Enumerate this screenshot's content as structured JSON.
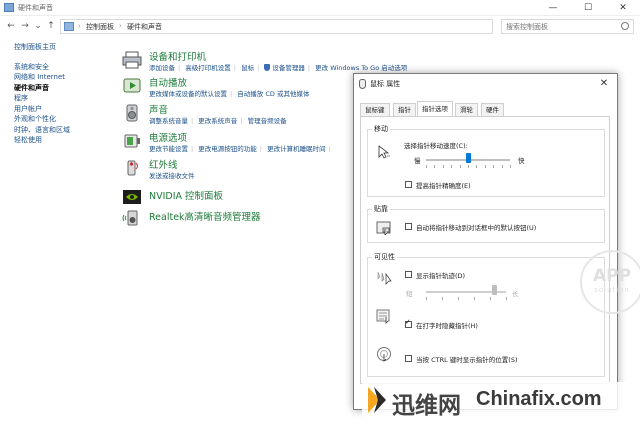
{
  "window": {
    "title": "硬件和声音",
    "minimize": "—",
    "maximize": "☐",
    "close": "✕"
  },
  "nav": {
    "back": "←",
    "forward": "→",
    "recent": "⌄",
    "up": "↑",
    "breadcrumb": [
      "控制面板",
      "硬件和声音"
    ],
    "breadcrumb_sep": "›",
    "search_placeholder": "搜索控制面板"
  },
  "sidebar": {
    "items": [
      {
        "label": "控制面板主页"
      },
      {
        "label": "系统和安全"
      },
      {
        "label": "网络和 Internet"
      },
      {
        "label": "硬件和声音"
      },
      {
        "label": "程序"
      },
      {
        "label": "用户帐户"
      },
      {
        "label": "外观和个性化"
      },
      {
        "label": "时钟、语言和区域"
      },
      {
        "label": "轻松使用"
      }
    ]
  },
  "categories": [
    {
      "title": "设备和打印机",
      "icon": "printer-icon",
      "links": [
        "添加设备",
        "高级打印机设置",
        "鼠标",
        "设备管理器",
        "更改 Windows To Go 启动选项"
      ]
    },
    {
      "title": "自动播放",
      "icon": "autoplay-icon",
      "links": [
        "更改媒体或设备的默认设置",
        "自动播放 CD 或其他媒体"
      ]
    },
    {
      "title": "声音",
      "icon": "speaker-icon",
      "links": [
        "调整系统音量",
        "更改系统声音",
        "管理音频设备"
      ]
    },
    {
      "title": "电源选项",
      "icon": "power-icon",
      "links": [
        "更改节能设置",
        "更改电源按钮的功能",
        "更改计算机睡眠时间"
      ]
    },
    {
      "title": "红外线",
      "icon": "infrared-icon",
      "links": [
        "发送或接收文件"
      ]
    },
    {
      "title": "NVIDIA 控制面板",
      "icon": "nvidia-icon",
      "links": []
    },
    {
      "title": "Realtek高清晰音频管理器",
      "icon": "realtek-icon",
      "links": []
    }
  ],
  "dialog": {
    "title": "鼠标 属性",
    "close": "✕",
    "tabs": [
      {
        "label": "鼠标键"
      },
      {
        "label": "指针"
      },
      {
        "label": "指针选项"
      },
      {
        "label": "滑轮"
      },
      {
        "label": "硬件"
      }
    ],
    "active_tab": "指针选项",
    "motion": {
      "group_label": "移动",
      "speed_label": "选择指针移动速度(C):",
      "slow": "慢",
      "fast": "快",
      "speed_fraction": 0.5,
      "precision_label": "提高指针精确度(E)",
      "precision_checked": false
    },
    "snap": {
      "group_label": "贴靠",
      "label": "自动将指针移动到对话框中的默认按钮(U)",
      "checked": false
    },
    "visibility": {
      "group_label": "可见性",
      "trails_label": "显示指针轨迹(D)",
      "trails_checked": false,
      "short": "短",
      "long": "长",
      "trail_fraction": 0.85,
      "hide_label": "在打字时隐藏指针(H)",
      "hide_checked": true,
      "ctrl_label": "当按 CTRL 键时显示指针的位置(S)",
      "ctrl_checked": false
    }
  },
  "watermark": {
    "app_big": "APP",
    "app_small": "solution",
    "brand_cn": "迅维网",
    "brand_en": "Chinafix.com"
  },
  "colors": {
    "category_title": "#1e7a3a",
    "link": "#1a4f8a",
    "accent": "#0078d7"
  }
}
